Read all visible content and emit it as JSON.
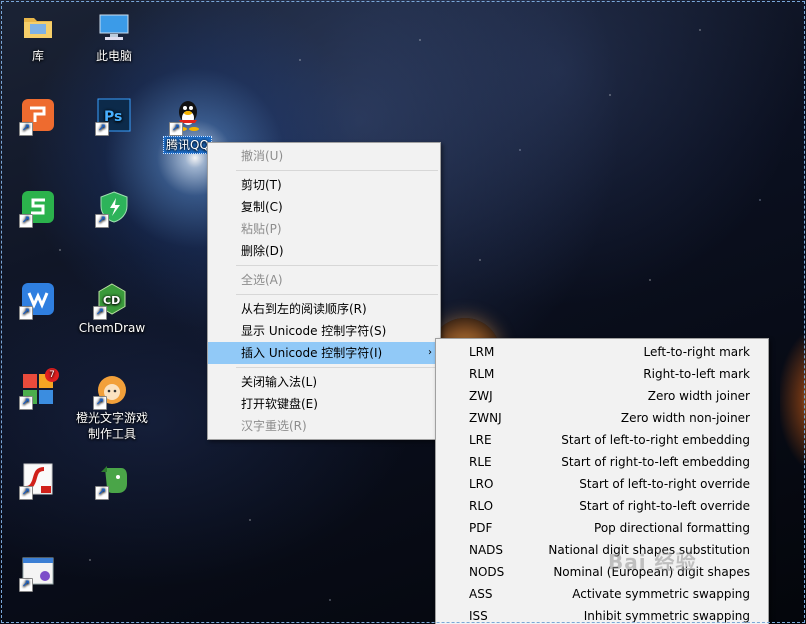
{
  "desktop_icons": [
    {
      "label": "库"
    },
    {
      "label": "此电脑"
    },
    {
      "label": ""
    },
    {
      "label": "腾讯QQ"
    },
    {
      "label": ""
    },
    {
      "label": ""
    },
    {
      "label": ""
    },
    {
      "label": "ChemDraw"
    },
    {
      "label": ""
    },
    {
      "label": "橙光文字游戏制作工具"
    },
    {
      "label": ""
    },
    {
      "label": ""
    },
    {
      "label": ""
    }
  ],
  "icon_texts": {
    "ps": "Ps",
    "cd": "CD",
    "badge": "7"
  },
  "context_menu": {
    "items": [
      {
        "label": "撤消(U)",
        "disabled": true
      },
      {
        "label": "剪切(T)",
        "disabled": false
      },
      {
        "label": "复制(C)",
        "disabled": false
      },
      {
        "label": "粘贴(P)",
        "disabled": true
      },
      {
        "label": "删除(D)",
        "disabled": false
      },
      {
        "label": "全选(A)",
        "disabled": true
      },
      {
        "label": "从右到左的阅读顺序(R)",
        "disabled": false
      },
      {
        "label": "显示 Unicode 控制字符(S)",
        "disabled": false
      },
      {
        "label": "插入 Unicode 控制字符(I)",
        "disabled": false,
        "highlighted": true
      },
      {
        "label": "关闭输入法(L)",
        "disabled": false
      },
      {
        "label": "打开软键盘(E)",
        "disabled": false
      },
      {
        "label": "汉字重选(R)",
        "disabled": true
      }
    ],
    "submenu_arrow": "›"
  },
  "unicode_submenu": {
    "items": [
      {
        "code": "LRM",
        "desc": "Left-to-right mark"
      },
      {
        "code": "RLM",
        "desc": "Right-to-left mark"
      },
      {
        "code": "ZWJ",
        "desc": "Zero width joiner"
      },
      {
        "code": "ZWNJ",
        "desc": "Zero width non-joiner"
      },
      {
        "code": "LRE",
        "desc": "Start of left-to-right embedding"
      },
      {
        "code": "RLE",
        "desc": "Start of right-to-left embedding"
      },
      {
        "code": "LRO",
        "desc": "Start of left-to-right override"
      },
      {
        "code": "RLO",
        "desc": "Start of right-to-left override"
      },
      {
        "code": "PDF",
        "desc": "Pop directional formatting"
      },
      {
        "code": "NADS",
        "desc": "National digit shapes substitution"
      },
      {
        "code": "NODS",
        "desc": "Nominal (European) digit shapes"
      },
      {
        "code": "ASS",
        "desc": "Activate symmetric swapping"
      },
      {
        "code": "ISS",
        "desc": "Inhibit symmetric swapping"
      }
    ]
  },
  "watermark": "Bai 经验",
  "colors": {
    "selection_blue": "#1d6cc6",
    "menu_bg": "#f2f2f2",
    "menu_highlight": "#91c9f7",
    "disabled_text": "#8d8d8d"
  }
}
